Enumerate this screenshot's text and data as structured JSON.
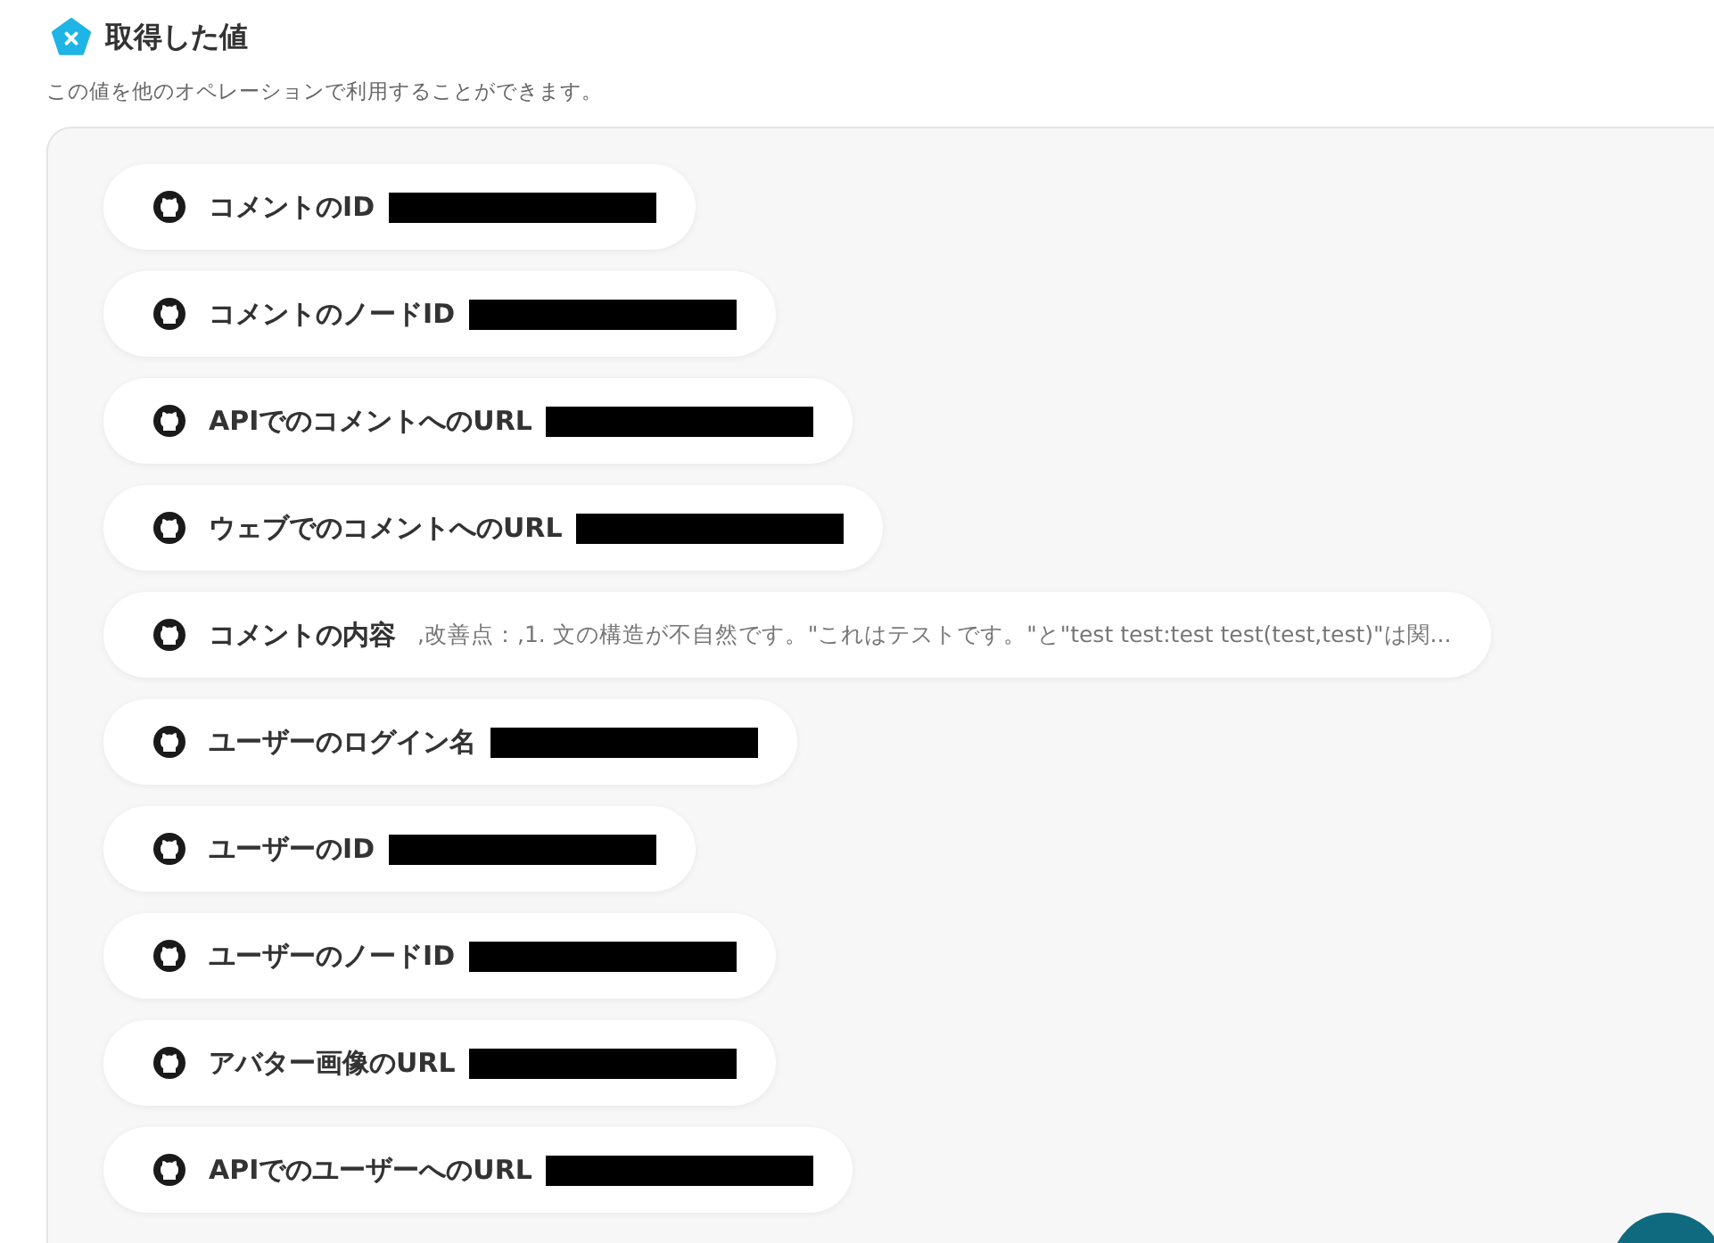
{
  "section": {
    "title": "取得した値",
    "description": "この値を他のオペレーションで利用することができます。"
  },
  "values": [
    {
      "label": "コメントのID",
      "kind": "redacted"
    },
    {
      "label": "コメントのノードID",
      "kind": "redacted"
    },
    {
      "label": "APIでのコメントへのURL",
      "kind": "redacted"
    },
    {
      "label": "ウェブでのコメントへのURL",
      "kind": "redacted"
    },
    {
      "label": "コメントの内容",
      "kind": "text",
      "value": ",改善点：,1. 文の構造が不自然です。\"これはテストです。\"と\"test test:test test(test,test)\"は関..."
    },
    {
      "label": "ユーザーのログイン名",
      "kind": "redacted"
    },
    {
      "label": "ユーザーのID",
      "kind": "redacted"
    },
    {
      "label": "ユーザーのノードID",
      "kind": "redacted"
    },
    {
      "label": "アバター画像のURL",
      "kind": "redacted"
    },
    {
      "label": "APIでのユーザーへのURL",
      "kind": "redacted"
    }
  ]
}
